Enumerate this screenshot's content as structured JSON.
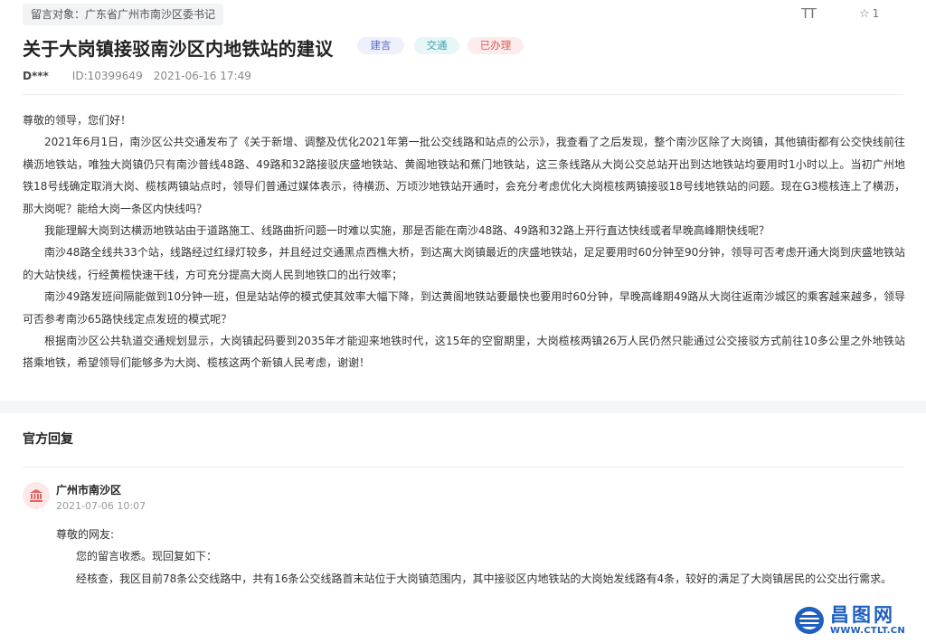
{
  "message": {
    "target": "留言对象：广东省广州市南沙区委书记",
    "title": "关于大岗镇接驳南沙区内地铁站的建议",
    "tags": [
      "建言",
      "交通",
      "已办理"
    ],
    "font_size_label": "TT",
    "favorite_count": "1",
    "author": "D***",
    "id_label": "ID:10399649",
    "datetime": "2021-06-16 17:49",
    "paragraphs": [
      "尊敬的领导，您们好！",
      "2021年6月1日，南沙区公共交通发布了《关于新增、调整及优化2021年第一批公交线路和站点的公示》，我查看了之后发现，整个南沙区除了大岗镇，其他镇街都有公交快线前往横沥地铁站，唯独大岗镇仍只有南沙普线48路、49路和32路接驳庆盛地铁站、黄阁地铁站和蕉门地铁站，这三条线路从大岗公交总站开出到达地铁站均要用时1小时以上。当初广州地铁18号线确定取消大岗、榄核两镇站点时，领导们普通过媒体表示，待横沥、万顷沙地铁站开通时，会充分考虑优化大岗榄核两镇接驳18号线地铁站的问题。现在G3榄核连上了横沥，那大岗呢？能给大岗一条区内快线吗？",
      "我能理解大岗到达横沥地铁站由于道路施工、线路曲折问题一时难以实施，那是否能在南沙48路、49路和32路上开行直达快线或者早晚高峰期快线呢？",
      "南沙48路全线共33个站，线路经过红绿灯较多，并且经过交通黑点西樵大桥，到达离大岗镇最近的庆盛地铁站，足足要用时60分钟至90分钟，领导可否考虑开通大岗到庆盛地铁站的大站快线，行经黄榄快速干线，方可充分提高大岗人民到地铁口的出行效率；",
      "南沙49路发班间隔能做到10分钟一班，但是站站停的模式使其效率大幅下降，到达黄阁地铁站要最快也要用时60分钟，早晚高峰期49路从大岗往返南沙城区的乘客越来越多，领导可否参考南沙65路快线定点发班的模式呢？",
      "根据南沙区公共轨道交通规划显示，大岗镇起码要到2035年才能迎来地铁时代，这15年的空窗期里，大岗榄核两镇26万人民仍然只能通过公交接驳方式前往10多公里之外地铁站搭乘地铁，希望领导们能够多为大岗、榄核这两个新镇人民考虑，谢谢！"
    ]
  },
  "reply": {
    "heading": "官方回复",
    "org": "广州市南沙区",
    "datetime": "2021-07-06 10:07",
    "paragraphs": [
      "尊敬的网友:",
      "您的留言收悉。现回复如下：",
      "经核查，我区目前78条公交线路中，共有16条公交线路首末站位于大岗镇范围内，其中接驳区内地铁站的大岗始发线路有4条，较好的满足了大岗镇居民的公交出行需求。"
    ]
  },
  "watermark": {
    "name": "昌图网",
    "url": "WWW.CTLT.CN"
  },
  "colors": {
    "accent_blue": "#1e5fbf",
    "tag_suggest": "#5667c8",
    "tag_traffic": "#3aa3b4",
    "tag_done": "#e05a5a",
    "avatar_icon": "#e06262"
  },
  "icons": {
    "font_size": "font-size-icon",
    "favorite": "star-outline-icon",
    "avatar": "government-building-icon",
    "watermark_logo": "disc-logo-icon"
  }
}
